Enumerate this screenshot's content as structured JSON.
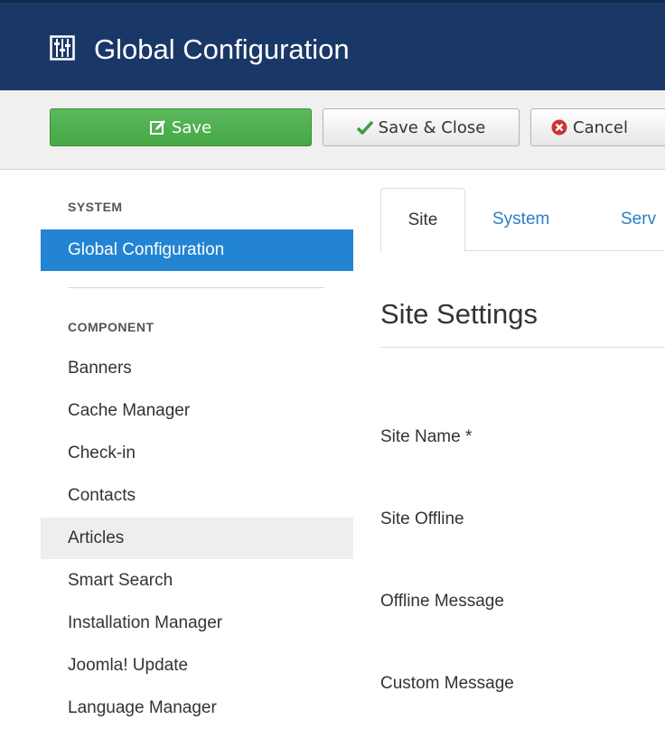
{
  "header": {
    "title": "Global Configuration",
    "icon": "equalizer-icon",
    "background": "#1a3867"
  },
  "toolbar": {
    "save_label": "Save",
    "save_close_label": "Save & Close",
    "cancel_label": "Cancel",
    "save_color": "#5cb85c"
  },
  "sidebar": {
    "system_header": "SYSTEM",
    "system_items": [
      {
        "label": "Global Configuration",
        "active": true
      }
    ],
    "component_header": "COMPONENT",
    "component_items": [
      {
        "label": "Banners"
      },
      {
        "label": "Cache Manager"
      },
      {
        "label": "Check-in"
      },
      {
        "label": "Contacts"
      },
      {
        "label": "Articles",
        "hover": true
      },
      {
        "label": "Smart Search"
      },
      {
        "label": "Installation Manager"
      },
      {
        "label": "Joomla! Update"
      },
      {
        "label": "Language Manager"
      }
    ],
    "active_color": "#2384d3"
  },
  "main": {
    "tabs": [
      {
        "label": "Site",
        "active": true
      },
      {
        "label": "System"
      },
      {
        "label": "Serv"
      }
    ],
    "section_title": "Site Settings",
    "fields": [
      {
        "label": "Site Name *"
      },
      {
        "label": "Site Offline"
      },
      {
        "label": "Offline Message"
      },
      {
        "label": "Custom Message"
      }
    ]
  }
}
